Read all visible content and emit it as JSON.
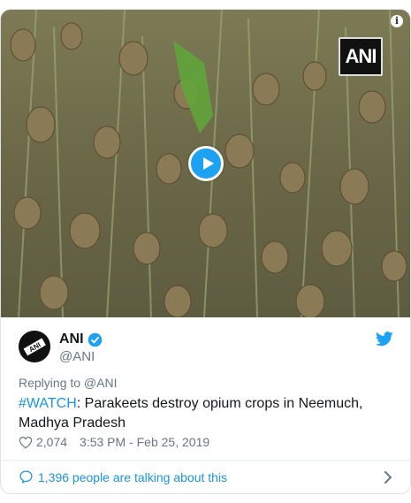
{
  "media": {
    "watermark": "ANI",
    "info_icon": "info-icon",
    "play_icon": "play-icon"
  },
  "author": {
    "name": "ANI",
    "handle": "@ANI",
    "verified_icon": "verified-badge-icon",
    "platform_icon": "twitter-bird-icon"
  },
  "tweet": {
    "replying_to": "Replying to @ANI",
    "hashtag": "#WATCH",
    "text": ": Parakeets destroy opium crops in Neemuch, Madhya Pradesh",
    "likes": "2,074",
    "timestamp": "3:53 PM - Feb 25, 2019"
  },
  "footer": {
    "talking_label": "1,396 people are talking about this"
  },
  "colors": {
    "accent": "#1da1f2",
    "link": "#1b95e0",
    "muted": "#657786",
    "text": "#14171a"
  }
}
